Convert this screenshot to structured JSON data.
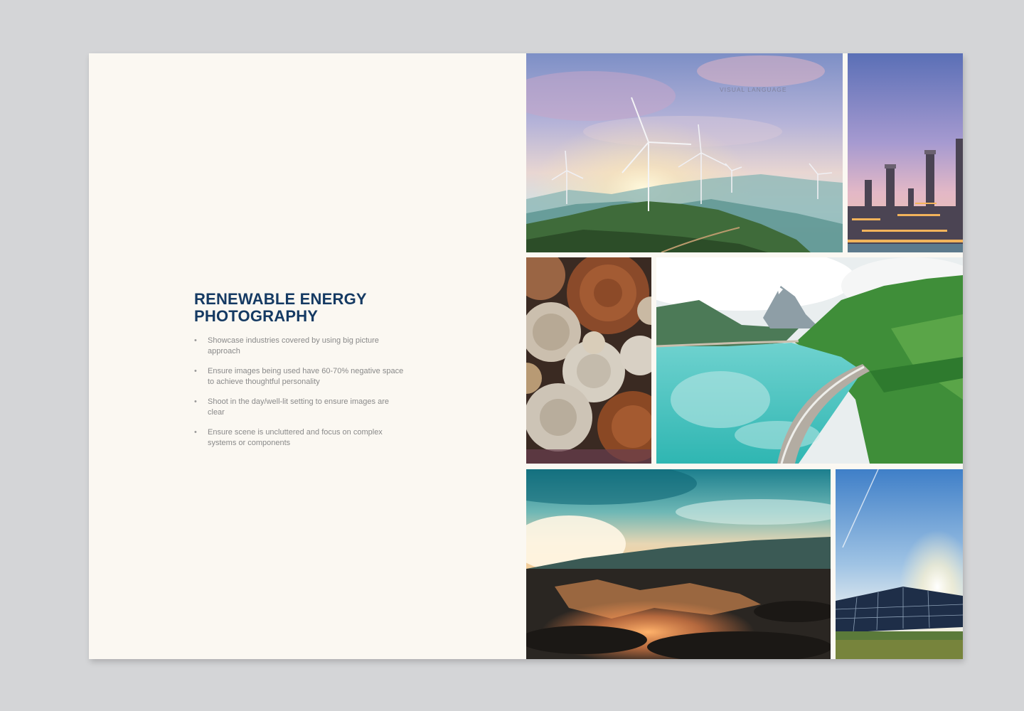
{
  "page": {
    "running_header": "VISUAL LANGUAGE",
    "heading_lines": [
      "RENEWABLE ENERGY",
      "PHOTOGRAPHY"
    ],
    "bullet_glyph": "•",
    "bullets": [
      "Showcase industries covered by using big picture approach",
      "Ensure images being used have 60-70% negative space to achieve thoughtful personality",
      "Shoot in the day/well-lit setting to ensure images are clear",
      "Ensure scene is uncluttered and focus on complex systems or components"
    ]
  },
  "colors": {
    "background": "#d4d5d7",
    "paper": "#fbf8f2",
    "heading": "#153a63",
    "body_text": "#8a8a8a"
  },
  "photos": [
    "wind-turbines-photo",
    "power-plant-photo",
    "stacked-logs-photo",
    "dam-lake-photo",
    "lava-field-photo",
    "solar-panels-photo"
  ]
}
